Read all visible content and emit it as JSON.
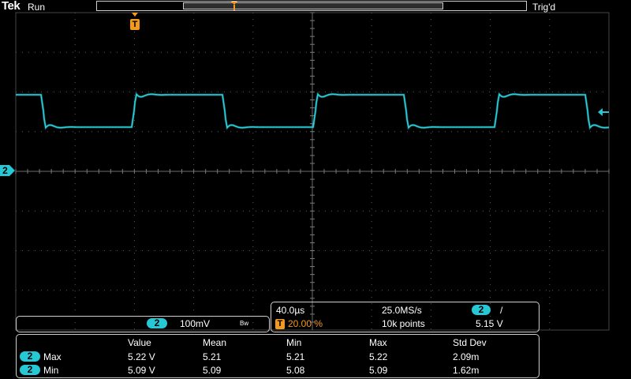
{
  "header": {
    "brand": "Tek",
    "run_state": "Run",
    "trigger_status": "Trig'd"
  },
  "markers": {
    "trigger_marker": "T",
    "channel_marker": "2"
  },
  "colors": {
    "trace": "#2ad0dc",
    "grid": "#5a5a5a",
    "trigger": "#f39a1e",
    "channel_badge": "#27c8d6"
  },
  "channel_box": {
    "channel": "2",
    "scale": "100mV",
    "bw_symbol": "Bw"
  },
  "timebase": {
    "horizontal_scale": "40.0µs",
    "sample_rate": "25.0MS/s",
    "trigger_channel": "2",
    "trigger_slope_symbol": "/",
    "trigger_position_icon": "T",
    "trigger_position": "20.00 %",
    "record_length": "10k points",
    "trigger_level": "5.15 V"
  },
  "measurements": {
    "headers": [
      "Value",
      "Mean",
      "Min",
      "Max",
      "Std Dev"
    ],
    "rows": [
      {
        "channel": "2",
        "label": "Max",
        "values": [
          "5.22 V",
          "5.21",
          "5.21",
          "5.22",
          "2.09m"
        ]
      },
      {
        "channel": "2",
        "label": "Min",
        "values": [
          "5.09 V",
          "5.09",
          "5.08",
          "5.09",
          "1.62m"
        ]
      }
    ]
  }
}
